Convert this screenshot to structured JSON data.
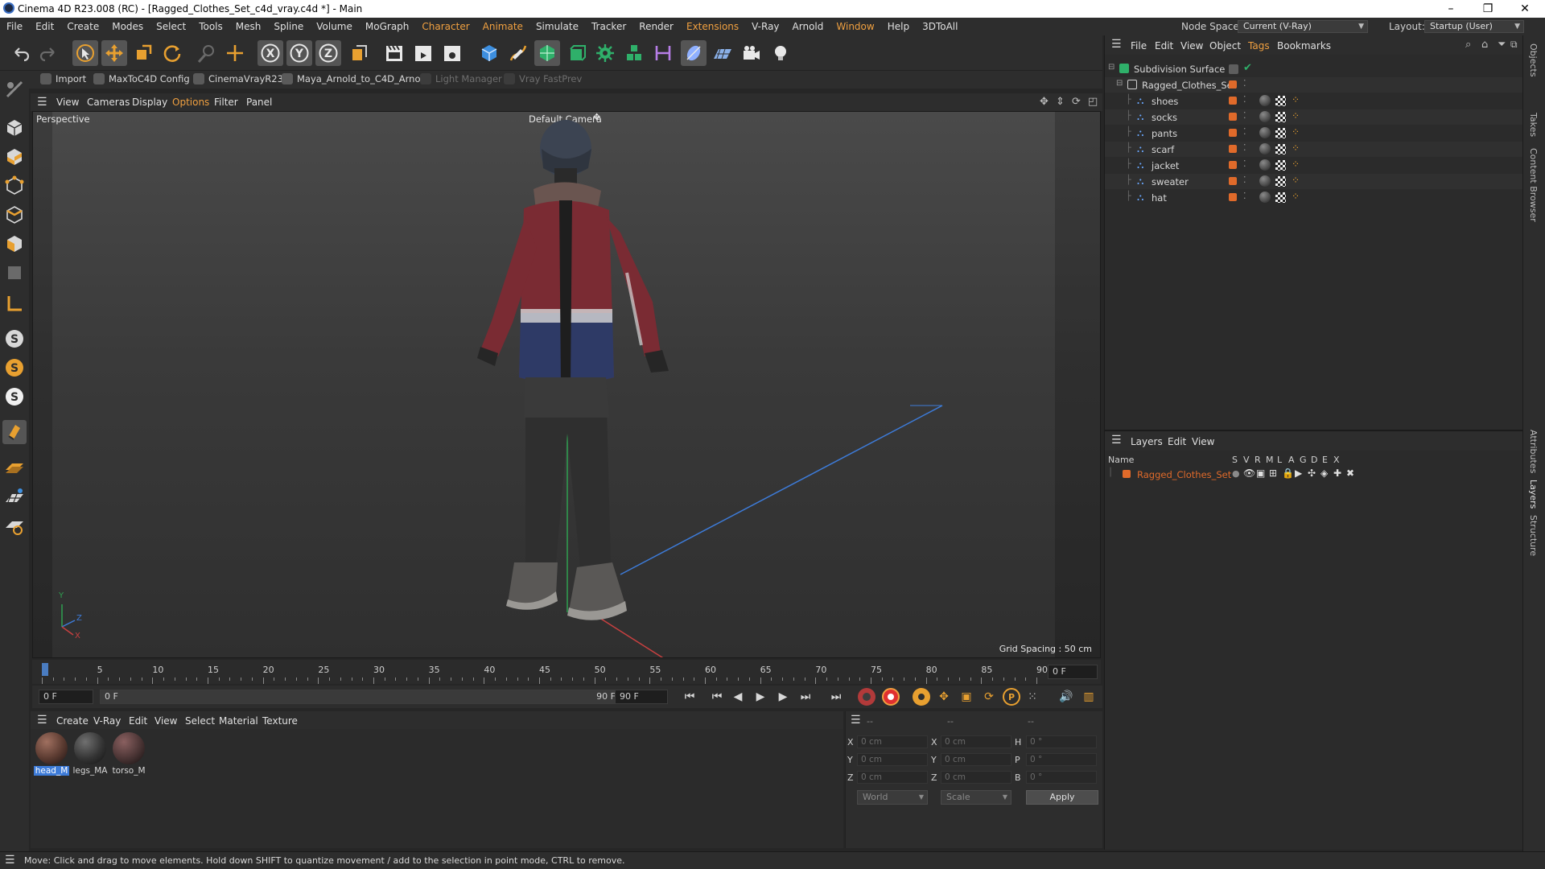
{
  "window": {
    "title": "Cinema 4D R23.008 (RC) - [Ragged_Clothes_Set_c4d_vray.c4d *] - Main",
    "controls": [
      "–",
      "❐",
      "✕"
    ]
  },
  "menubar": {
    "items": [
      {
        "label": "File"
      },
      {
        "label": "Edit"
      },
      {
        "label": "Create"
      },
      {
        "label": "Modes"
      },
      {
        "label": "Select"
      },
      {
        "label": "Tools"
      },
      {
        "label": "Mesh"
      },
      {
        "label": "Spline"
      },
      {
        "label": "Volume"
      },
      {
        "label": "MoGraph"
      },
      {
        "label": "Character",
        "orange": true
      },
      {
        "label": "Animate",
        "orange": true
      },
      {
        "label": "Simulate"
      },
      {
        "label": "Tracker"
      },
      {
        "label": "Render"
      },
      {
        "label": "Extensions",
        "orange": true
      },
      {
        "label": "V-Ray"
      },
      {
        "label": "Arnold"
      },
      {
        "label": "Window",
        "orange": true
      },
      {
        "label": "Help"
      },
      {
        "label": "3DToAll"
      }
    ],
    "node_space_label": "Node Space:",
    "node_space_value": "Current (V-Ray)",
    "layout_label": "Layout:",
    "layout_value": "Startup (User)"
  },
  "pluginbar": {
    "items": [
      {
        "label": "Import",
        "disabled": false
      },
      {
        "label": "MaxToC4D Config",
        "disabled": false
      },
      {
        "label": "CinemaVrayR23",
        "disabled": false
      },
      {
        "label": "Maya_Arnold_to_C4D_Arnold",
        "disabled": false
      },
      {
        "label": "Light Manager",
        "disabled": true
      },
      {
        "label": "Vray FastPrev",
        "disabled": true
      }
    ]
  },
  "viewport": {
    "menu": [
      "View",
      "Cameras",
      "Display",
      "Options",
      "Filter",
      "Panel"
    ],
    "view_name": "Perspective",
    "camera_label": "Default Camera",
    "grid_spacing": "Grid Spacing : 50 cm",
    "axis_labels": {
      "y": "Y",
      "z": "Z",
      "x": "X"
    }
  },
  "timeline": {
    "ticks": [
      "0",
      "5",
      "10",
      "15",
      "20",
      "25",
      "30",
      "35",
      "40",
      "45",
      "50",
      "55",
      "60",
      "65",
      "70",
      "75",
      "80",
      "85",
      "90"
    ],
    "current_frame_box": "0 F",
    "start_field": "0 F",
    "range_start": "0 F",
    "range_end": "90 F",
    "end_field": "90 F"
  },
  "materials": {
    "menu": [
      "Create",
      "V-Ray",
      "Edit",
      "View",
      "Select",
      "Material",
      "Texture"
    ],
    "items": [
      {
        "name": "head_M",
        "selected": true
      },
      {
        "name": "legs_MA",
        "selected": false
      },
      {
        "name": "torso_M",
        "selected": false
      }
    ]
  },
  "coords": {
    "headers": [
      "--",
      "--",
      "--"
    ],
    "rows": [
      {
        "l1": "X",
        "v1": "0 cm",
        "l2": "X",
        "v2": "0 cm",
        "l3": "H",
        "v3": "0 °"
      },
      {
        "l1": "Y",
        "v1": "0 cm",
        "l2": "Y",
        "v2": "0 cm",
        "l3": "P",
        "v3": "0 °"
      },
      {
        "l1": "Z",
        "v1": "0 cm",
        "l2": "Z",
        "v2": "0 cm",
        "l3": "B",
        "v3": "0 °"
      }
    ],
    "mode_dropdown": "World",
    "scale_dropdown": "Scale",
    "apply_label": "Apply"
  },
  "objects": {
    "menu": [
      "File",
      "Edit",
      "View",
      "Object",
      "Tags",
      "Bookmarks"
    ],
    "tags_menu_orange": "Tags",
    "items": [
      {
        "name": "Subdivision Surface",
        "level": 0
      },
      {
        "name": "Ragged_Clothes_Set",
        "level": 1
      },
      {
        "name": "shoes",
        "level": 2
      },
      {
        "name": "socks",
        "level": 2
      },
      {
        "name": "pants",
        "level": 2
      },
      {
        "name": "scarf",
        "level": 2
      },
      {
        "name": "jacket",
        "level": 2
      },
      {
        "name": "sweater",
        "level": 2
      },
      {
        "name": "hat",
        "level": 2
      }
    ]
  },
  "layers": {
    "menu": [
      "Layers",
      "Edit",
      "View"
    ],
    "columns": [
      "Name",
      "S",
      "V",
      "R",
      "M",
      "L",
      "A",
      "G",
      "D",
      "E",
      "X"
    ],
    "items": [
      {
        "name": "Ragged_Clothes_Set",
        "color": "#e06a2a"
      }
    ]
  },
  "side_tabs": [
    "Objects",
    "Takes",
    "Content Browser",
    "Attributes",
    "Layers",
    "Structure"
  ],
  "status": {
    "text": "Move: Click and drag to move elements. Hold down SHIFT to quantize movement / add to the selection in point mode, CTRL to remove."
  },
  "colors": {
    "accent_orange": "#e06a2a",
    "selection_blue": "#3d7bd8",
    "menu_orange": "#f0a040"
  }
}
